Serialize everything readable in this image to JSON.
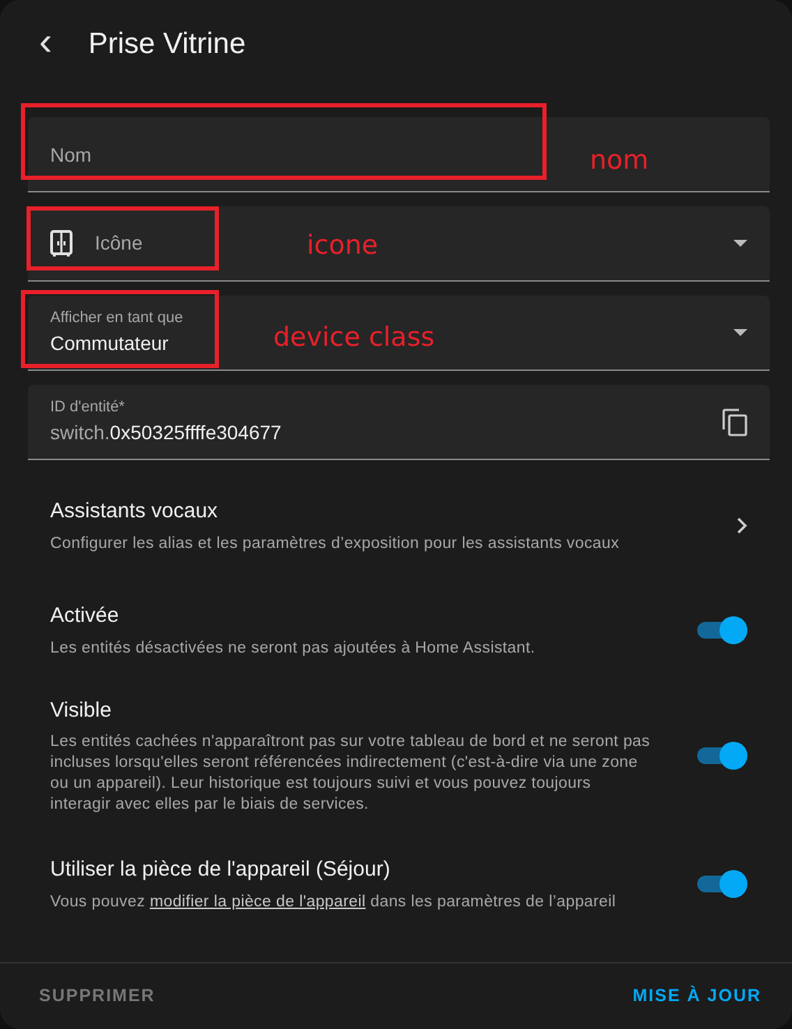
{
  "header": {
    "back_icon": "‹",
    "title": "Prise Vitrine"
  },
  "fields": [
    {
      "kind": "text",
      "placeholder": "Nom",
      "annotation": "nom"
    },
    {
      "kind": "icon",
      "label": "Icône",
      "annotation": "icone"
    },
    {
      "kind": "select",
      "label": "Afficher en tant que",
      "value": "Commutateur",
      "annotation": "device class"
    },
    {
      "kind": "entity",
      "label": "ID d'entité*",
      "value_prefix": "switch.",
      "value": "0x50325ffffe304677"
    }
  ],
  "assistants": {
    "title": "Assistants vocaux",
    "description": "Configurer les alias et les paramètres d’exposition pour les assistants vocaux"
  },
  "settings": [
    {
      "title": "Activée",
      "description": "Les entités désactivées ne seront pas ajoutées à Home Assistant.",
      "on": true
    },
    {
      "title": "Visible",
      "description": "Les entités cachées n'apparaîtront pas sur votre tableau de bord et ne seront pas incluses lorsqu'elles seront référencées indirectement (c'est-à-dire via une zone ou un appareil). Leur historique est toujours suivi et vous pouvez toujours interagir avec elles par le biais de services.",
      "on": true
    },
    {
      "title": "Utiliser la pièce de l'appareil (Séjour)",
      "description_before": "Vous pouvez ",
      "link": "modifier la pièce de l'appareil",
      "description_after": " dans les paramètres de l’appareil",
      "on": true
    }
  ],
  "footer": {
    "delete_button": "SUPPRIMER",
    "update_button": "MISE À JOUR"
  }
}
